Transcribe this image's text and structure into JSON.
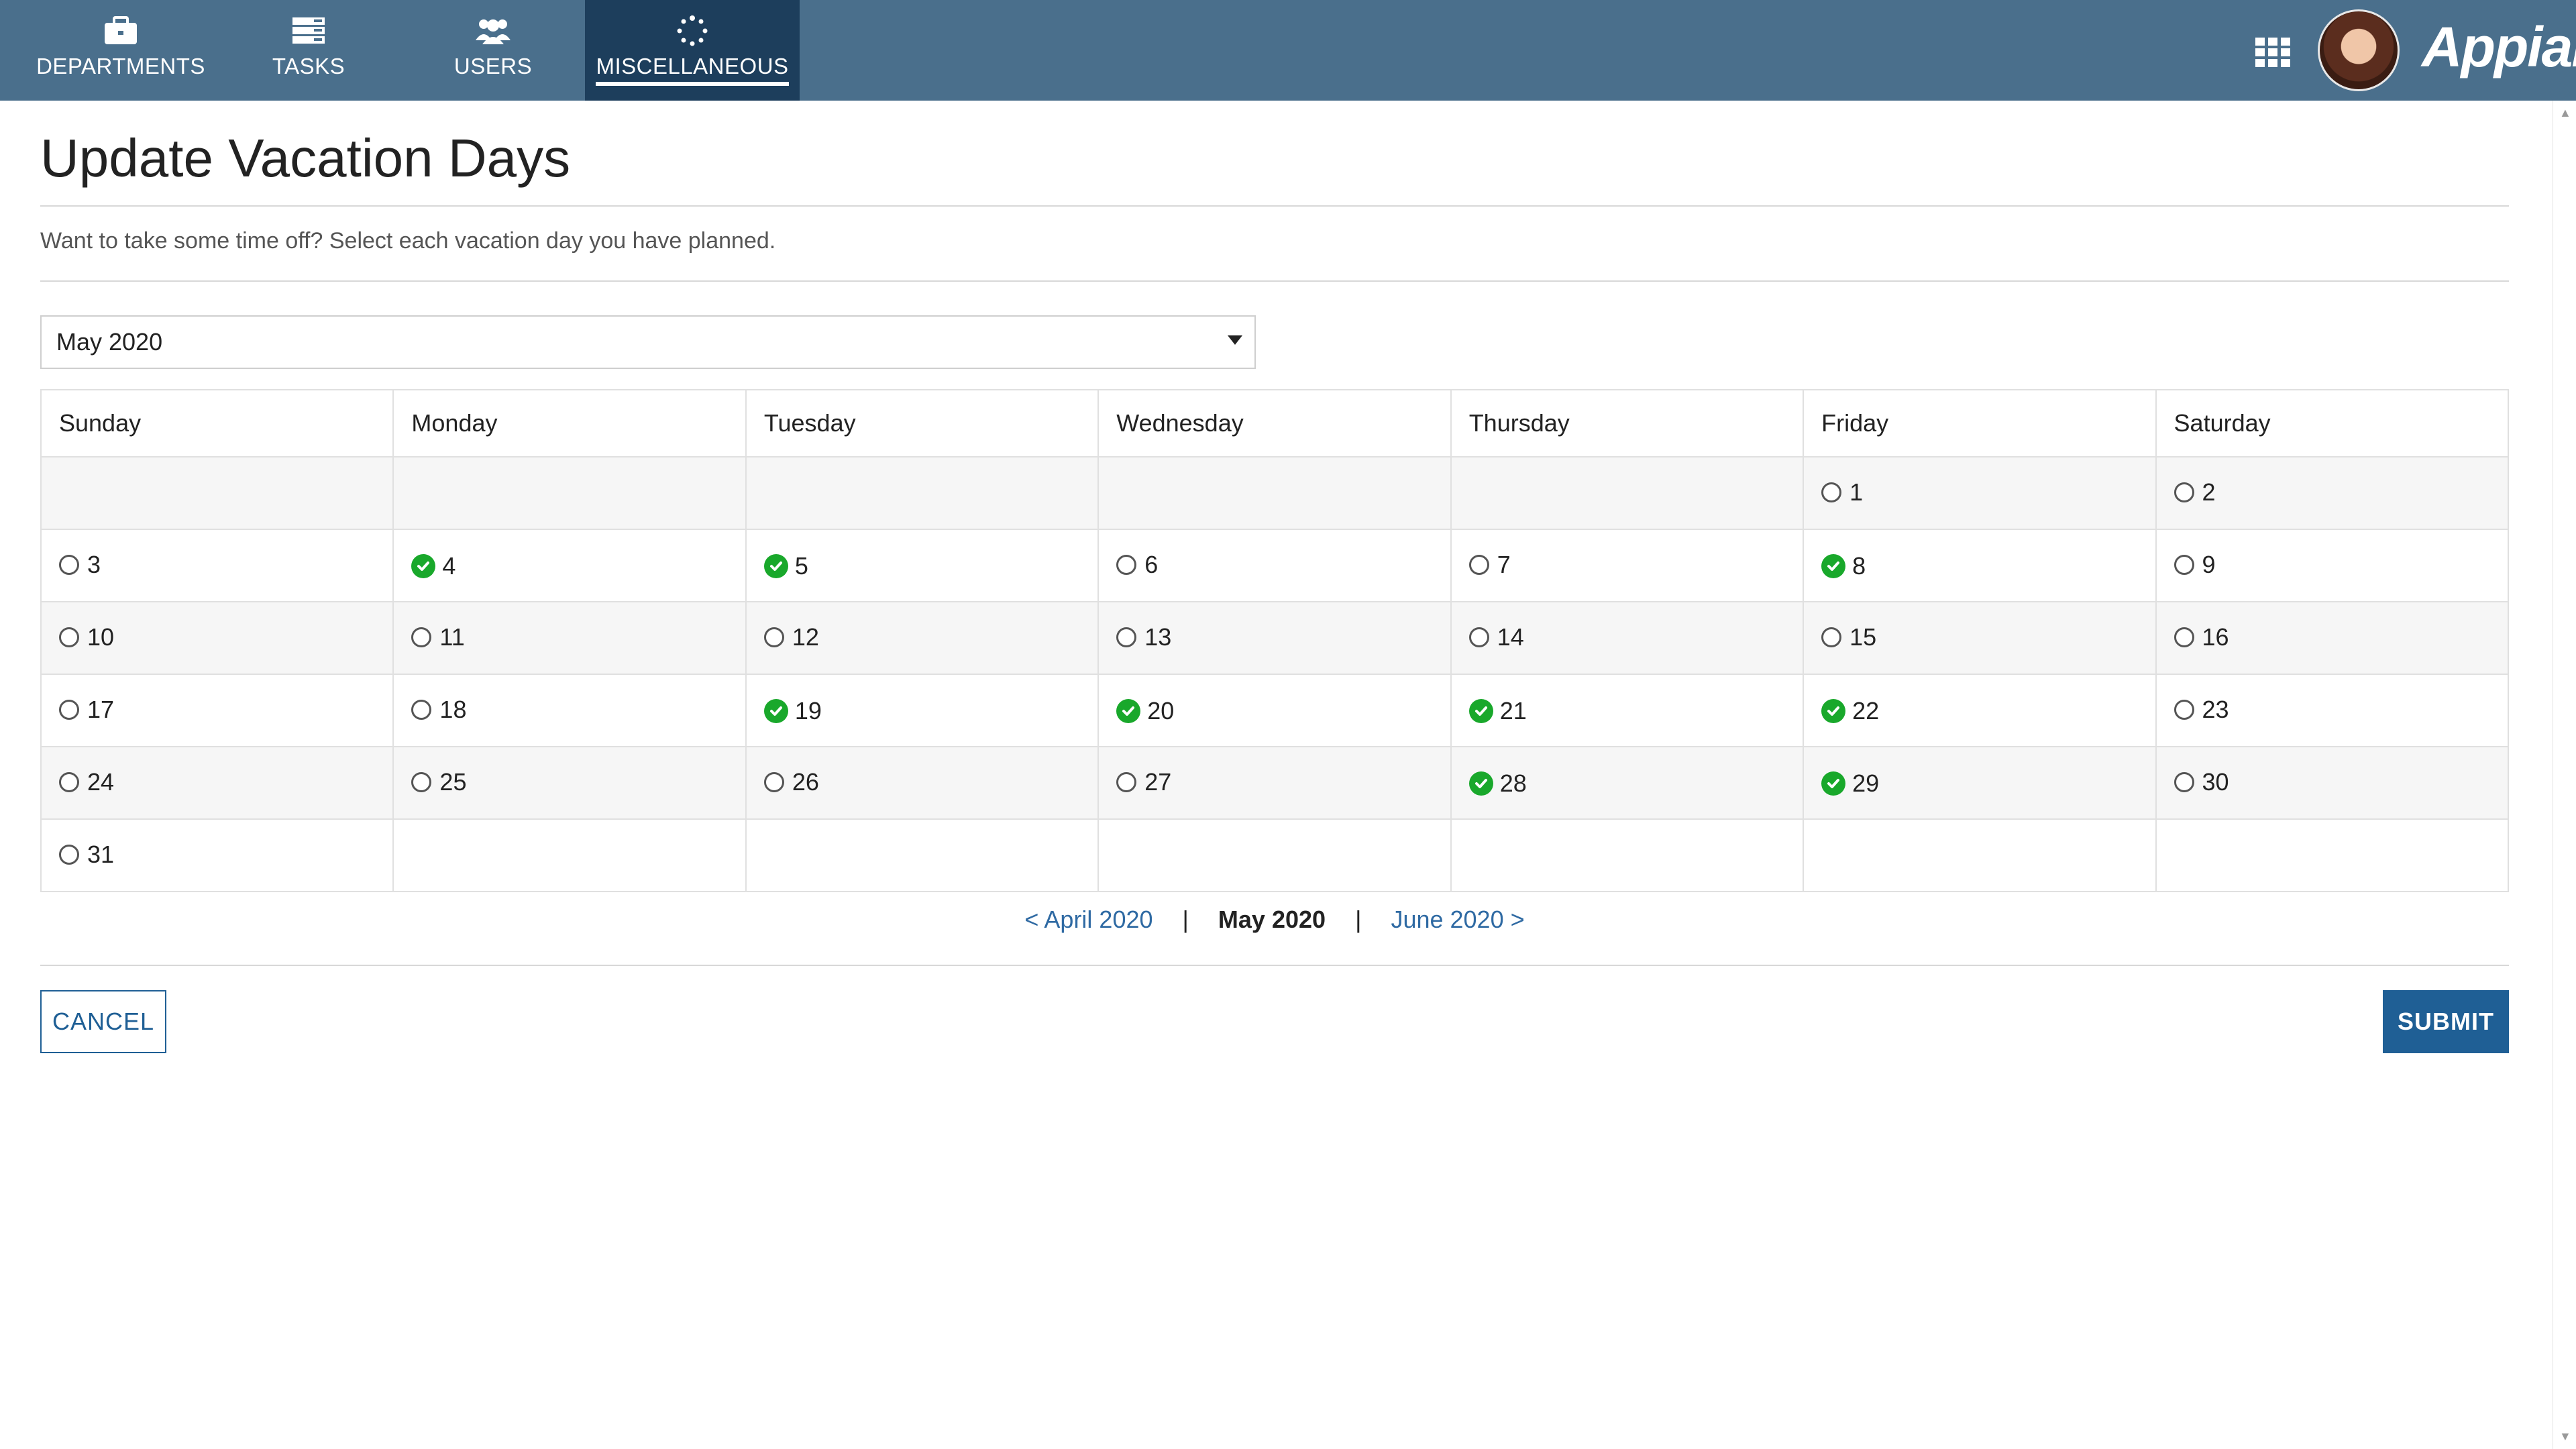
{
  "nav": {
    "tabs": [
      {
        "label": "DEPARTMENTS",
        "icon": "briefcase-icon",
        "active": false
      },
      {
        "label": "TASKS",
        "icon": "tasks-icon",
        "active": false
      },
      {
        "label": "USERS",
        "icon": "users-icon",
        "active": false
      },
      {
        "label": "MISCELLANEOUS",
        "icon": "spinner-icon",
        "active": true
      }
    ],
    "apps_icon": "grid-icon",
    "logo": "Appian"
  },
  "page": {
    "title": "Update Vacation Days",
    "instructions": "Want to take some time off? Select each vacation day you have planned.",
    "month_select": {
      "value": "May 2020"
    }
  },
  "calendar": {
    "weekdays": [
      "Sunday",
      "Monday",
      "Tuesday",
      "Wednesday",
      "Thursday",
      "Friday",
      "Saturday"
    ],
    "weeks": [
      [
        null,
        null,
        null,
        null,
        null,
        {
          "day": "1",
          "selected": false
        },
        {
          "day": "2",
          "selected": false
        }
      ],
      [
        {
          "day": "3",
          "selected": false
        },
        {
          "day": "4",
          "selected": true
        },
        {
          "day": "5",
          "selected": true
        },
        {
          "day": "6",
          "selected": false
        },
        {
          "day": "7",
          "selected": false
        },
        {
          "day": "8",
          "selected": true
        },
        {
          "day": "9",
          "selected": false
        }
      ],
      [
        {
          "day": "10",
          "selected": false
        },
        {
          "day": "11",
          "selected": false
        },
        {
          "day": "12",
          "selected": false
        },
        {
          "day": "13",
          "selected": false
        },
        {
          "day": "14",
          "selected": false
        },
        {
          "day": "15",
          "selected": false
        },
        {
          "day": "16",
          "selected": false
        }
      ],
      [
        {
          "day": "17",
          "selected": false
        },
        {
          "day": "18",
          "selected": false
        },
        {
          "day": "19",
          "selected": true
        },
        {
          "day": "20",
          "selected": true
        },
        {
          "day": "21",
          "selected": true
        },
        {
          "day": "22",
          "selected": true
        },
        {
          "day": "23",
          "selected": false
        }
      ],
      [
        {
          "day": "24",
          "selected": false
        },
        {
          "day": "25",
          "selected": false
        },
        {
          "day": "26",
          "selected": false
        },
        {
          "day": "27",
          "selected": false
        },
        {
          "day": "28",
          "selected": true
        },
        {
          "day": "29",
          "selected": true
        },
        {
          "day": "30",
          "selected": false
        }
      ],
      [
        {
          "day": "31",
          "selected": false
        },
        null,
        null,
        null,
        null,
        null,
        null
      ]
    ],
    "selected_color": "#19a82b"
  },
  "pager": {
    "prev": "< April 2020",
    "current": "May 2020",
    "next": "June 2020 >"
  },
  "buttons": {
    "cancel": "CANCEL",
    "submit": "SUBMIT"
  },
  "colors": {
    "nav_bg": "#4a6f8c",
    "nav_active_bg": "#1d3e5c",
    "primary": "#1f5f95"
  }
}
